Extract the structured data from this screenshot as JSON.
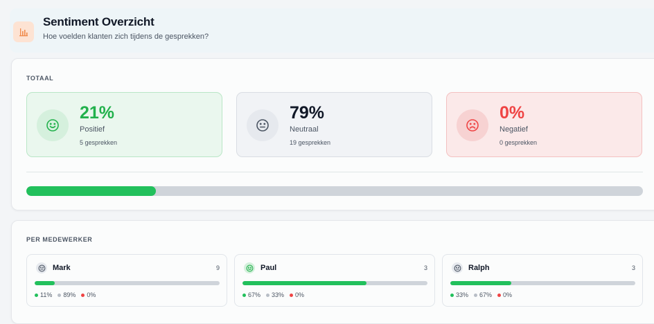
{
  "header": {
    "title": "Sentiment Overzicht",
    "subtitle": "Hoe voelden klanten zich tijdens de gesprekken?",
    "icon": "bar-chart-icon"
  },
  "totaal": {
    "label": "TOTAAL",
    "stats": [
      {
        "pct": "21%",
        "name": "Positief",
        "count": "5 gesprekken",
        "icon": "smile-icon"
      },
      {
        "pct": "79%",
        "name": "Neutraal",
        "count": "19 gesprekken",
        "icon": "neutral-face-icon"
      },
      {
        "pct": "0%",
        "name": "Negatief",
        "count": "0 gesprekken",
        "icon": "frown-icon"
      }
    ],
    "positive_fraction": 0.21
  },
  "per_medewerker": {
    "label": "PER MEDEWERKER",
    "employees": [
      {
        "name": "Mark",
        "count": "9",
        "pos": "11%",
        "neu": "89%",
        "neg": "0%",
        "positive_fraction": 0.11,
        "icon": "neutral-face-icon"
      },
      {
        "name": "Paul",
        "count": "3",
        "pos": "67%",
        "neu": "33%",
        "neg": "0%",
        "positive_fraction": 0.67,
        "icon": "smile-icon"
      },
      {
        "name": "Ralph",
        "count": "3",
        "pos": "33%",
        "neu": "67%",
        "neg": "0%",
        "positive_fraction": 0.33,
        "icon": "neutral-face-icon"
      }
    ]
  },
  "colors": {
    "positive": "#22c05c",
    "neutral": "#b8bec6",
    "negative": "#ef4444",
    "accent": "#f4a26b"
  }
}
